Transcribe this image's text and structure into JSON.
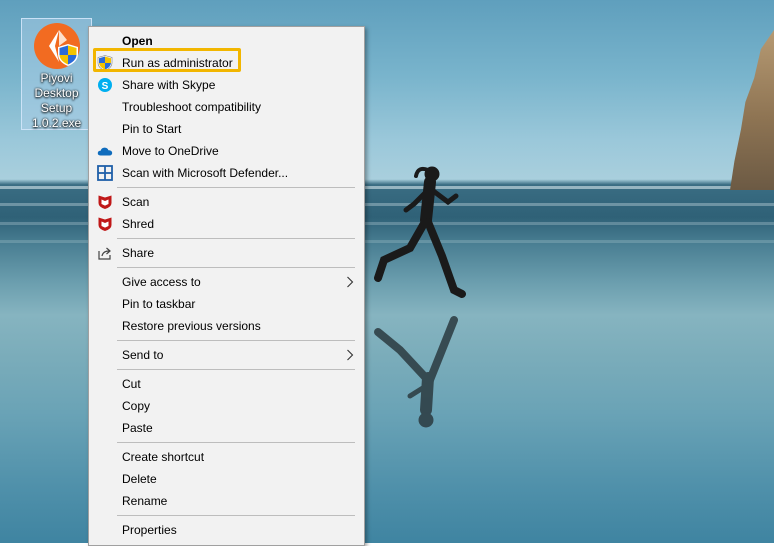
{
  "desktop": {
    "icon_label": "Piyovi Desktop Setup 1.0.2.exe"
  },
  "menu": {
    "open": "Open",
    "run_as_admin": "Run as administrator",
    "share_skype": "Share with Skype",
    "troubleshoot": "Troubleshoot compatibility",
    "pin_start": "Pin to Start",
    "move_onedrive": "Move to OneDrive",
    "scan_defender": "Scan with Microsoft Defender...",
    "scan": "Scan",
    "shred": "Shred",
    "share": "Share",
    "give_access": "Give access to",
    "pin_taskbar": "Pin to taskbar",
    "restore_versions": "Restore previous versions",
    "send_to": "Send to",
    "cut": "Cut",
    "copy": "Copy",
    "paste": "Paste",
    "create_shortcut": "Create shortcut",
    "delete": "Delete",
    "rename": "Rename",
    "properties": "Properties"
  },
  "icons": {
    "app": "piyovi-logo-with-uac-shield",
    "uac": "uac-shield-icon",
    "skype": "skype-icon",
    "onedrive": "onedrive-cloud-icon",
    "defender": "defender-icon",
    "mcafee": "mcafee-shield-icon",
    "share": "share-icon",
    "submenu": "chevron-right-icon"
  },
  "colors": {
    "highlight": "#f2b600",
    "menu_bg": "#f2f2f2",
    "app_orange": "#f26b21",
    "mcafee_red": "#c01818",
    "skype_blue": "#00aff0",
    "onedrive_blue": "#0f6cbd"
  }
}
